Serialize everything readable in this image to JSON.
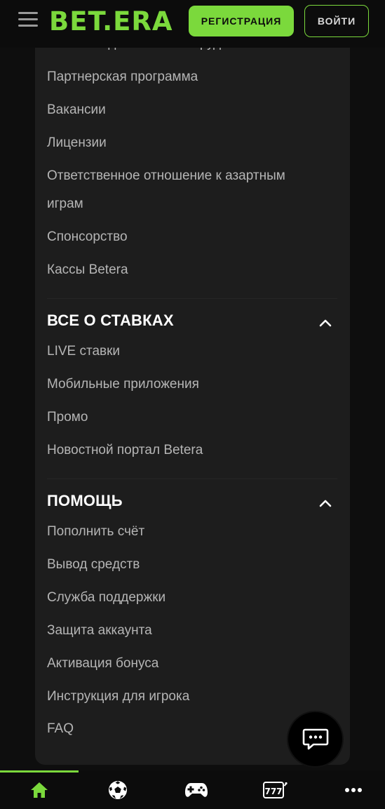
{
  "header": {
    "logo_text": "BET.ERA",
    "register_label": "РЕГИСТРАЦИЯ",
    "login_label": "ВОЙТИ",
    "menu_icon": "hamburger-menu-icon"
  },
  "about": {
    "cut_item": "Контакты для СМИ и сотрудничества",
    "items": [
      "Партнерская программа",
      "Вакансии",
      "Лицензии",
      "Ответственное отношение к азартным",
      "играм",
      "Спонсорство",
      "Кассы Betera"
    ]
  },
  "betting": {
    "title": "ВСЕ О СТАВКАХ",
    "items": [
      "LIVE ставки",
      "Мобильные приложения",
      "Промо",
      "Новостной портал Betera"
    ]
  },
  "help": {
    "title": "ПОМОЩЬ",
    "items": [
      "Пополнить счёт",
      "Вывод средств",
      "Служба поддержки",
      "Защита аккаунта",
      "Активация бонуса",
      "Инструкция для игрока",
      "FAQ"
    ]
  },
  "bottom_nav": {
    "items": [
      "home-icon",
      "football-icon",
      "gamepad-icon",
      "slots-777-icon",
      "more-dots-icon"
    ],
    "active": "home-icon"
  },
  "colors": {
    "accent": "#7bd93c",
    "background": "#0e0e0e",
    "panel": "#1d1d1d",
    "text": "#b5b5b5",
    "heading": "#ffffff"
  }
}
